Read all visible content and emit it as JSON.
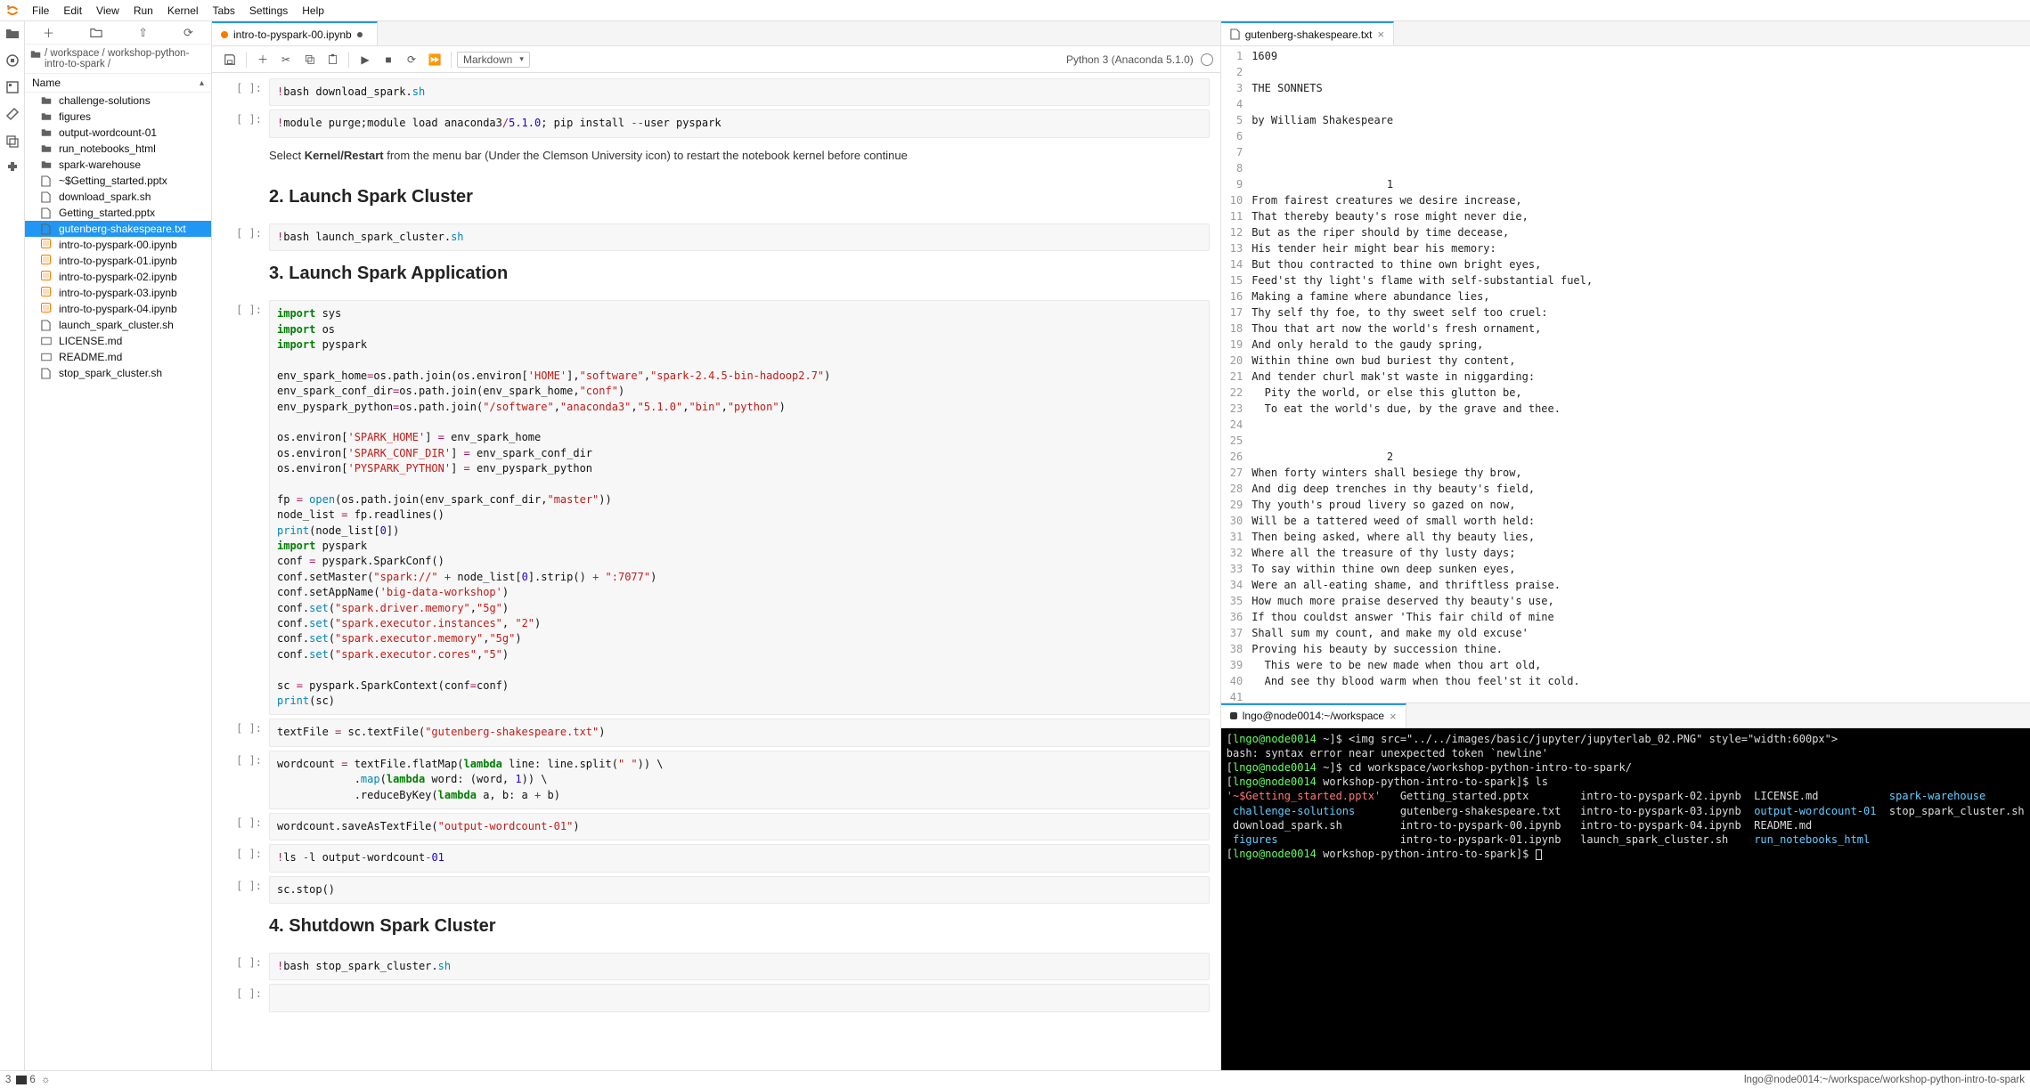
{
  "menu": [
    "File",
    "Edit",
    "View",
    "Run",
    "Kernel",
    "Tabs",
    "Settings",
    "Help"
  ],
  "breadcrumb": "/ workspace / workshop-python-intro-to-spark /",
  "nameHeader": "Name",
  "tree": [
    {
      "icon": "folder",
      "label": "challenge-solutions"
    },
    {
      "icon": "folder",
      "label": "figures"
    },
    {
      "icon": "folder",
      "label": "output-wordcount-01"
    },
    {
      "icon": "folder",
      "label": "run_notebooks_html"
    },
    {
      "icon": "folder",
      "label": "spark-warehouse"
    },
    {
      "icon": "file",
      "label": "~$Getting_started.pptx"
    },
    {
      "icon": "file",
      "label": "download_spark.sh"
    },
    {
      "icon": "file",
      "label": "Getting_started.pptx"
    },
    {
      "icon": "file",
      "label": "gutenberg-shakespeare.txt",
      "selected": true
    },
    {
      "icon": "nb",
      "label": "intro-to-pyspark-00.ipynb"
    },
    {
      "icon": "nb",
      "label": "intro-to-pyspark-01.ipynb"
    },
    {
      "icon": "nb",
      "label": "intro-to-pyspark-02.ipynb"
    },
    {
      "icon": "nb",
      "label": "intro-to-pyspark-03.ipynb"
    },
    {
      "icon": "nb",
      "label": "intro-to-pyspark-04.ipynb"
    },
    {
      "icon": "file",
      "label": "launch_spark_cluster.sh"
    },
    {
      "icon": "md",
      "label": "LICENSE.md"
    },
    {
      "icon": "md",
      "label": "README.md"
    },
    {
      "icon": "file",
      "label": "stop_spark_cluster.sh"
    }
  ],
  "nbTab": "intro-to-pyspark-00.ipynb",
  "cellType": "Markdown",
  "kernelName": "Python 3 (Anaconda 5.1.0)",
  "mdRestart": {
    "pre": "Select ",
    "b": "Kernel/Restart",
    "post": " from the menu bar (Under the Clemson University icon) to restart the notebook kernel before continue"
  },
  "h2a": "2. Launch Spark Cluster",
  "h2b": "3. Launch Spark Application",
  "h2c": "4. Shutdown Spark Cluster",
  "edTab": "gutenberg-shakespeare.txt",
  "termTab": "lngo@node0014:~/workspace",
  "editorLines": [
    "1609",
    "",
    "THE SONNETS",
    "",
    "by William Shakespeare",
    "",
    "",
    "",
    "                     1",
    "From fairest creatures we desire increase,",
    "That thereby beauty's rose might never die,",
    "But as the riper should by time decease,",
    "His tender heir might bear his memory:",
    "But thou contracted to thine own bright eyes,",
    "Feed'st thy light's flame with self-substantial fuel,",
    "Making a famine where abundance lies,",
    "Thy self thy foe, to thy sweet self too cruel:",
    "Thou that art now the world's fresh ornament,",
    "And only herald to the gaudy spring,",
    "Within thine own bud buriest thy content,",
    "And tender churl mak'st waste in niggarding:",
    "  Pity the world, or else this glutton be,",
    "  To eat the world's due, by the grave and thee.",
    "",
    "",
    "                     2",
    "When forty winters shall besiege thy brow,",
    "And dig deep trenches in thy beauty's field,",
    "Thy youth's proud livery so gazed on now,",
    "Will be a tattered weed of small worth held:",
    "Then being asked, where all thy beauty lies,",
    "Where all the treasure of thy lusty days;",
    "To say within thine own deep sunken eyes,",
    "Were an all-eating shame, and thriftless praise.",
    "How much more praise deserved thy beauty's use,",
    "If thou couldst answer 'This fair child of mine",
    "Shall sum my count, and make my old excuse'",
    "Proving his beauty by succession thine.",
    "  This were to be new made when thou art old,",
    "  And see thy blood warm when thou feel'st it cold.",
    "",
    ""
  ],
  "statusLeft": "3",
  "statusMid": "6",
  "statusRight": "lngo@node0014:~/workspace/workshop-python-intro-to-spark"
}
